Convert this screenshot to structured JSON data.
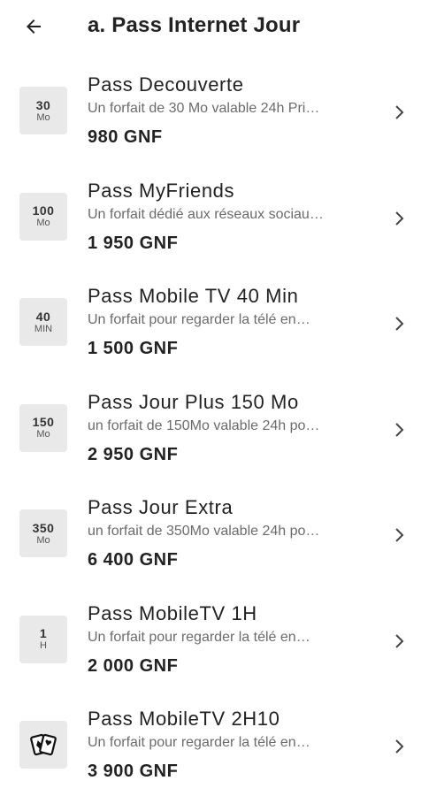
{
  "header": {
    "title": "a. Pass Internet Jour",
    "back_icon": "arrow-left-icon"
  },
  "colors": {
    "badge_bg": "#e9e9e9",
    "text_primary": "#222222",
    "text_secondary": "#6b6b6b"
  },
  "items": [
    {
      "badge_top": "30",
      "badge_bottom": "Mo",
      "name": "Pass Decouverte",
      "description": "Un forfait de 30 Mo valable 24h  Pri…",
      "price": "980 GNF"
    },
    {
      "badge_top": "100",
      "badge_bottom": "Mo",
      "name": "Pass MyFriends",
      "description": "Un forfait dédié aux réseaux sociau…",
      "price": "1 950 GNF"
    },
    {
      "badge_top": "40",
      "badge_bottom": "MIN",
      "name": "Pass Mobile TV 40 Min",
      "description": "Un forfait  pour regarder la télé en…",
      "price": "1 500 GNF"
    },
    {
      "badge_top": "150",
      "badge_bottom": "Mo",
      "name": "Pass Jour Plus 150 Mo",
      "description": "un forfait de 150Mo valable 24h po…",
      "price": "2 950 GNF"
    },
    {
      "badge_top": "350",
      "badge_bottom": "Mo",
      "name": "Pass Jour Extra",
      "description": "un forfait de 350Mo valable 24h po…",
      "price": "6 400 GNF"
    },
    {
      "badge_top": "1",
      "badge_bottom": "H",
      "name": "Pass MobileTV 1H",
      "description": "Un forfait  pour regarder la télé en…",
      "price": "2 000 GNF"
    },
    {
      "badge_icon": "playing-cards-icon",
      "name": "Pass MobileTV 2H10",
      "description": "Un forfait  pour regarder la télé en…",
      "price": "3 900 GNF"
    }
  ]
}
